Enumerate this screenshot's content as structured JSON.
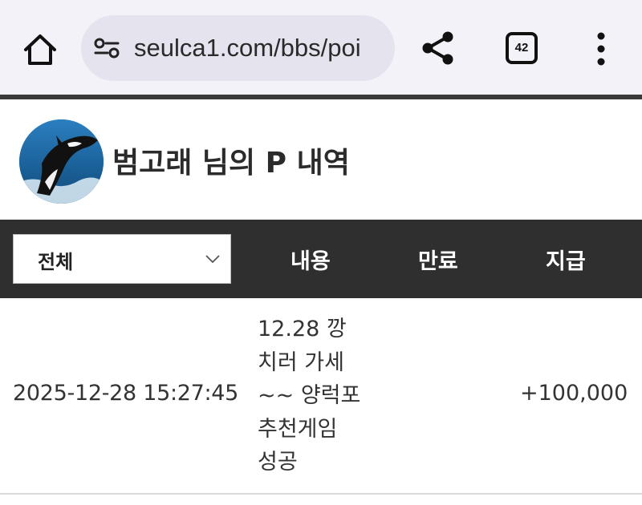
{
  "browser": {
    "url": "seulca1.com/bbs/poi",
    "tab_count": "42"
  },
  "profile": {
    "title": "범고래 님의 P 내역"
  },
  "table": {
    "filter_selected": "전체",
    "headers": [
      "내용",
      "만료",
      "지급"
    ],
    "rows": [
      {
        "date": "2025-12-28 15:27:45",
        "content_lines": [
          "12.28 깡",
          "치러 가세",
          "~~ 양럭포",
          "추천게임",
          "성공"
        ],
        "expire": "",
        "amount": "+100,000"
      }
    ]
  },
  "colors": {
    "browser_bg": "#f3f2f8",
    "url_pill": "#e4e3ee",
    "header_bar": "#2f2f2f",
    "header_text": "#ffffff"
  }
}
